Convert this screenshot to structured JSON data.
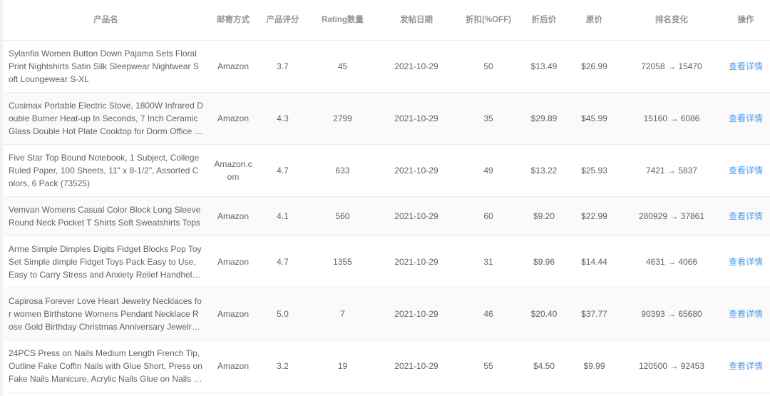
{
  "headers": {
    "name": "产品名",
    "shipping": "邮寄方式",
    "rating": "产品评分",
    "rating_count": "Rating数量",
    "date": "发帖日期",
    "discount": "折扣(%OFF)",
    "sale_price": "折后价",
    "orig_price": "原价",
    "rank": "排名变化",
    "action": "操作"
  },
  "rows": [
    {
      "name": "Sylanfia Women Button Down Pajama Sets Floral Print Nightshirts Satin Silk Sleepwear Nightwear Soft Loungewear S-XL",
      "shipping": "Amazon",
      "rating": "3.7",
      "rating_count": "45",
      "date": "2021-10-29",
      "discount": "50",
      "sale_price": "$13.49",
      "orig_price": "$26.99",
      "rank": "72058 → 15470",
      "action": "查看详情"
    },
    {
      "name": "Cusimax Portable Electric Stove, 1800W Infrared Double Burner Heat-up In Seconds, 7 Inch Ceramic Glass Double Hot Plate Cooktop for Dorm Office Home Camp",
      "shipping": "Amazon",
      "rating": "4.3",
      "rating_count": "2799",
      "date": "2021-10-29",
      "discount": "35",
      "sale_price": "$29.89",
      "orig_price": "$45.99",
      "rank": "15160 → 6086",
      "action": "查看详情"
    },
    {
      "name": "Five Star Top Bound Notebook, 1 Subject, College Ruled Paper, 100 Sheets, 11\" x 8-1/2\", Assorted Colors, 6 Pack (73525)",
      "shipping": "Amazon.com",
      "rating": "4.7",
      "rating_count": "633",
      "date": "2021-10-29",
      "discount": "49",
      "sale_price": "$13.22",
      "orig_price": "$25.93",
      "rank": "7421 → 5837",
      "action": "查看详情"
    },
    {
      "name": "Vemvan Womens Casual Color Block Long Sleeve Round Neck Pocket T Shirts Soft Sweatshirts Tops",
      "shipping": "Amazon",
      "rating": "4.1",
      "rating_count": "560",
      "date": "2021-10-29",
      "discount": "60",
      "sale_price": "$9.20",
      "orig_price": "$22.99",
      "rank": "280929 → 37861",
      "action": "查看详情"
    },
    {
      "name": "Arme Simple Dimples Digits Fidget Blocks Pop Toy Set Simple dimple Fidget Toys Pack Easy to Use, Easy to Carry Stress and Anxiety Relief Handheld Toys for Kids",
      "shipping": "Amazon",
      "rating": "4.7",
      "rating_count": "1355",
      "date": "2021-10-29",
      "discount": "31",
      "sale_price": "$9.96",
      "orig_price": "$14.44",
      "rank": "4631 → 4066",
      "action": "查看详情"
    },
    {
      "name": "Capirosa Forever Love Heart Jewelry Necklaces for women Birthstone Womens Pendant Necklace Rose Gold Birthday Christmas Anniversary Jewelry Gifts for Women",
      "shipping": "Amazon",
      "rating": "5.0",
      "rating_count": "7",
      "date": "2021-10-29",
      "discount": "46",
      "sale_price": "$20.40",
      "orig_price": "$37.77",
      "rank": "90393 → 65680",
      "action": "查看详情"
    },
    {
      "name": "24PCS Press on Nails Medium Length French Tip, Outline Fake Coffin Nails with Glue Short, Press on Fake Nails Manicure, Acrylic Nails Glue on Nails for Women",
      "shipping": "Amazon",
      "rating": "3.2",
      "rating_count": "19",
      "date": "2021-10-29",
      "discount": "55",
      "sale_price": "$4.50",
      "orig_price": "$9.99",
      "rank": "120500 → 92453",
      "action": "查看详情"
    }
  ]
}
